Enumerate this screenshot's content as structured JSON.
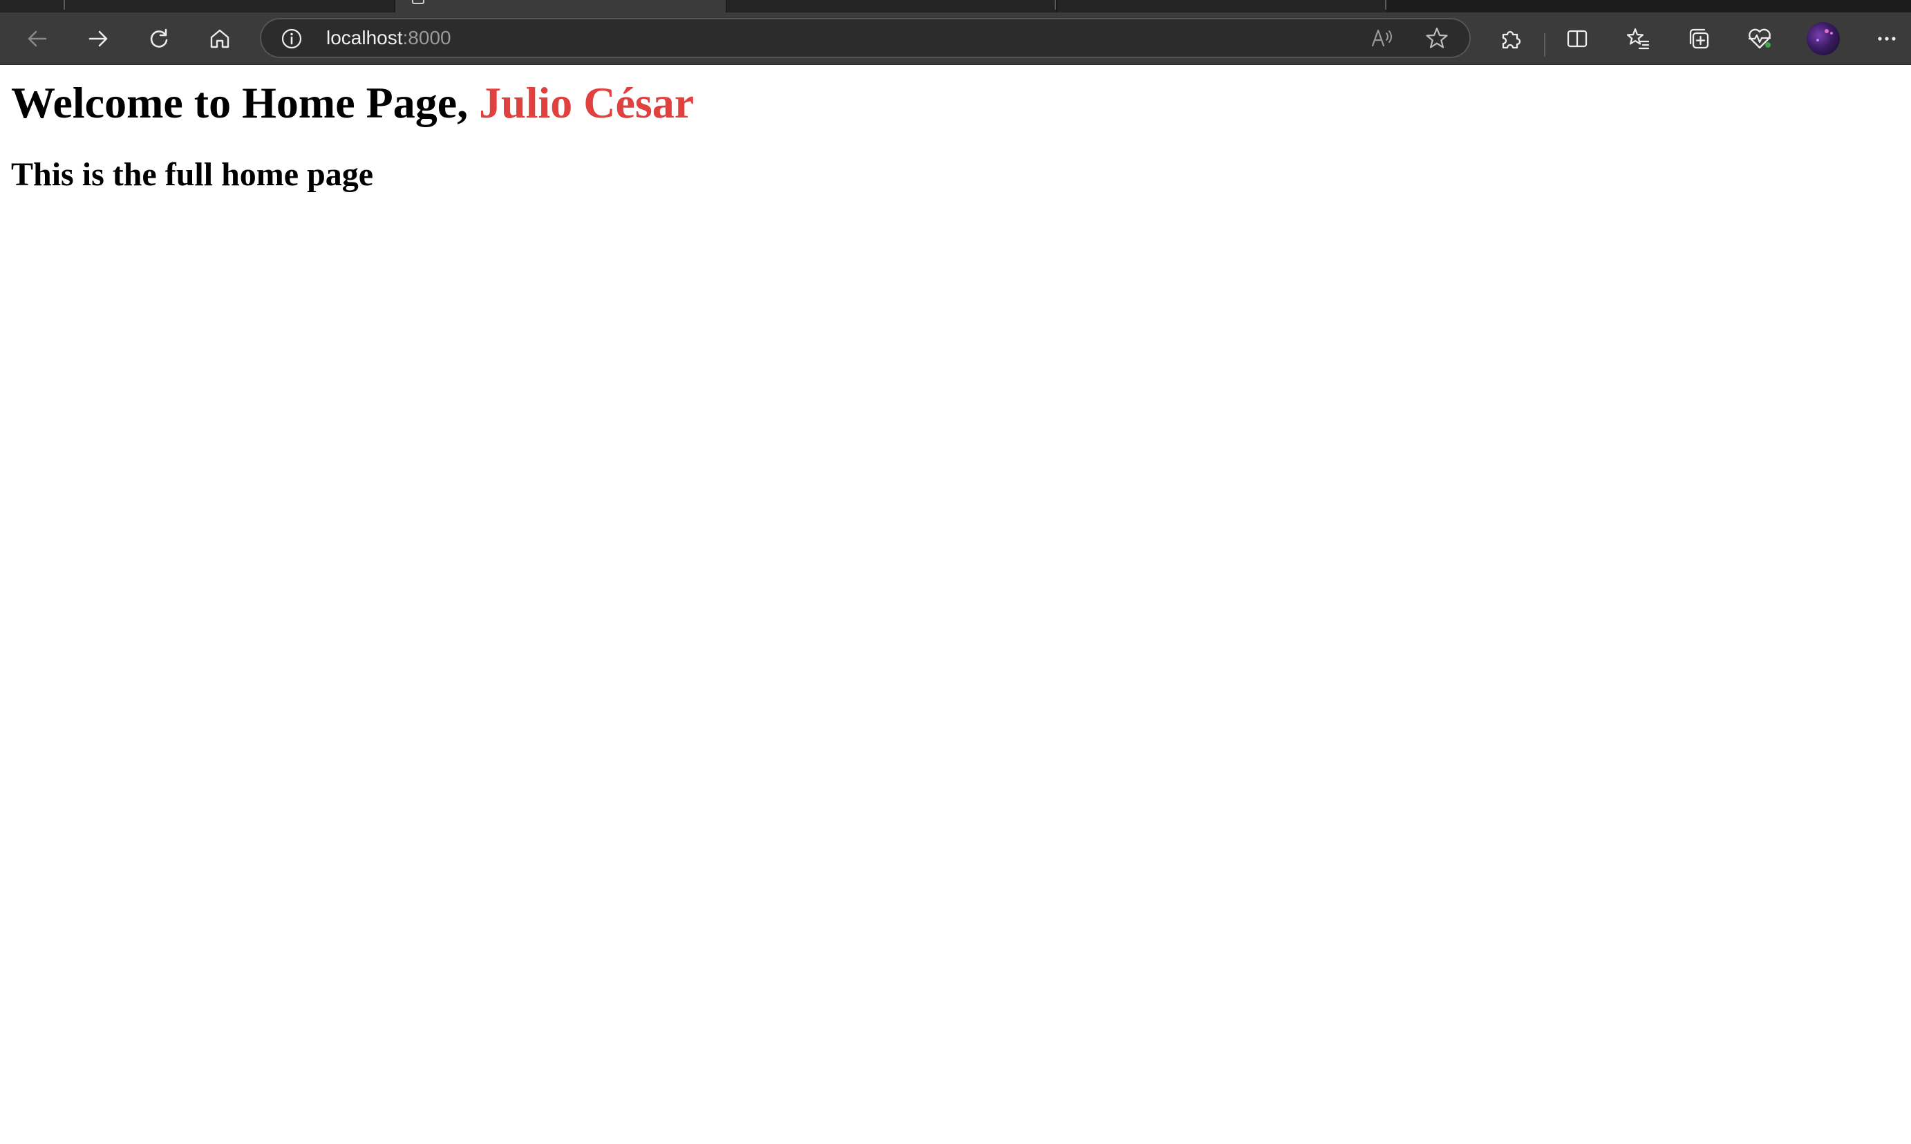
{
  "browser": {
    "address_bar": {
      "host": "localhost",
      "port": ":8000"
    },
    "icons": {
      "back": "back-arrow-icon",
      "forward": "forward-arrow-icon",
      "refresh": "refresh-icon",
      "home": "home-icon",
      "site_info": "info-icon",
      "read_aloud": "read-aloud-icon",
      "favorite": "star-icon",
      "extensions": "puzzle-icon",
      "split_screen": "split-screen-icon",
      "favorites": "favorites-icon",
      "collections": "collections-icon",
      "browser_essentials": "heart-pulse-icon",
      "menu": "more-icon"
    }
  },
  "page": {
    "heading_prefix": "Welcome to Home Page, ",
    "heading_name": "Julio César",
    "heading_name_color": "#e0403e",
    "subheading": "This is the full home page"
  }
}
